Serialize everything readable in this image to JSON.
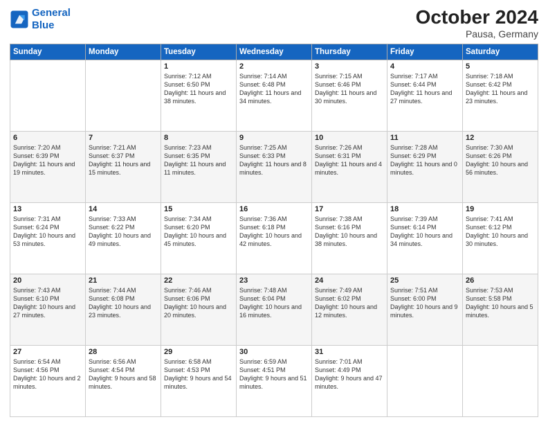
{
  "logo": {
    "line1": "General",
    "line2": "Blue"
  },
  "header": {
    "month": "October 2024",
    "location": "Pausa, Germany"
  },
  "days_of_week": [
    "Sunday",
    "Monday",
    "Tuesday",
    "Wednesday",
    "Thursday",
    "Friday",
    "Saturday"
  ],
  "weeks": [
    [
      {
        "num": "",
        "detail": ""
      },
      {
        "num": "",
        "detail": ""
      },
      {
        "num": "1",
        "detail": "Sunrise: 7:12 AM\nSunset: 6:50 PM\nDaylight: 11 hours and 38 minutes."
      },
      {
        "num": "2",
        "detail": "Sunrise: 7:14 AM\nSunset: 6:48 PM\nDaylight: 11 hours and 34 minutes."
      },
      {
        "num": "3",
        "detail": "Sunrise: 7:15 AM\nSunset: 6:46 PM\nDaylight: 11 hours and 30 minutes."
      },
      {
        "num": "4",
        "detail": "Sunrise: 7:17 AM\nSunset: 6:44 PM\nDaylight: 11 hours and 27 minutes."
      },
      {
        "num": "5",
        "detail": "Sunrise: 7:18 AM\nSunset: 6:42 PM\nDaylight: 11 hours and 23 minutes."
      }
    ],
    [
      {
        "num": "6",
        "detail": "Sunrise: 7:20 AM\nSunset: 6:39 PM\nDaylight: 11 hours and 19 minutes."
      },
      {
        "num": "7",
        "detail": "Sunrise: 7:21 AM\nSunset: 6:37 PM\nDaylight: 11 hours and 15 minutes."
      },
      {
        "num": "8",
        "detail": "Sunrise: 7:23 AM\nSunset: 6:35 PM\nDaylight: 11 hours and 11 minutes."
      },
      {
        "num": "9",
        "detail": "Sunrise: 7:25 AM\nSunset: 6:33 PM\nDaylight: 11 hours and 8 minutes."
      },
      {
        "num": "10",
        "detail": "Sunrise: 7:26 AM\nSunset: 6:31 PM\nDaylight: 11 hours and 4 minutes."
      },
      {
        "num": "11",
        "detail": "Sunrise: 7:28 AM\nSunset: 6:29 PM\nDaylight: 11 hours and 0 minutes."
      },
      {
        "num": "12",
        "detail": "Sunrise: 7:30 AM\nSunset: 6:26 PM\nDaylight: 10 hours and 56 minutes."
      }
    ],
    [
      {
        "num": "13",
        "detail": "Sunrise: 7:31 AM\nSunset: 6:24 PM\nDaylight: 10 hours and 53 minutes."
      },
      {
        "num": "14",
        "detail": "Sunrise: 7:33 AM\nSunset: 6:22 PM\nDaylight: 10 hours and 49 minutes."
      },
      {
        "num": "15",
        "detail": "Sunrise: 7:34 AM\nSunset: 6:20 PM\nDaylight: 10 hours and 45 minutes."
      },
      {
        "num": "16",
        "detail": "Sunrise: 7:36 AM\nSunset: 6:18 PM\nDaylight: 10 hours and 42 minutes."
      },
      {
        "num": "17",
        "detail": "Sunrise: 7:38 AM\nSunset: 6:16 PM\nDaylight: 10 hours and 38 minutes."
      },
      {
        "num": "18",
        "detail": "Sunrise: 7:39 AM\nSunset: 6:14 PM\nDaylight: 10 hours and 34 minutes."
      },
      {
        "num": "19",
        "detail": "Sunrise: 7:41 AM\nSunset: 6:12 PM\nDaylight: 10 hours and 30 minutes."
      }
    ],
    [
      {
        "num": "20",
        "detail": "Sunrise: 7:43 AM\nSunset: 6:10 PM\nDaylight: 10 hours and 27 minutes."
      },
      {
        "num": "21",
        "detail": "Sunrise: 7:44 AM\nSunset: 6:08 PM\nDaylight: 10 hours and 23 minutes."
      },
      {
        "num": "22",
        "detail": "Sunrise: 7:46 AM\nSunset: 6:06 PM\nDaylight: 10 hours and 20 minutes."
      },
      {
        "num": "23",
        "detail": "Sunrise: 7:48 AM\nSunset: 6:04 PM\nDaylight: 10 hours and 16 minutes."
      },
      {
        "num": "24",
        "detail": "Sunrise: 7:49 AM\nSunset: 6:02 PM\nDaylight: 10 hours and 12 minutes."
      },
      {
        "num": "25",
        "detail": "Sunrise: 7:51 AM\nSunset: 6:00 PM\nDaylight: 10 hours and 9 minutes."
      },
      {
        "num": "26",
        "detail": "Sunrise: 7:53 AM\nSunset: 5:58 PM\nDaylight: 10 hours and 5 minutes."
      }
    ],
    [
      {
        "num": "27",
        "detail": "Sunrise: 6:54 AM\nSunset: 4:56 PM\nDaylight: 10 hours and 2 minutes."
      },
      {
        "num": "28",
        "detail": "Sunrise: 6:56 AM\nSunset: 4:54 PM\nDaylight: 9 hours and 58 minutes."
      },
      {
        "num": "29",
        "detail": "Sunrise: 6:58 AM\nSunset: 4:53 PM\nDaylight: 9 hours and 54 minutes."
      },
      {
        "num": "30",
        "detail": "Sunrise: 6:59 AM\nSunset: 4:51 PM\nDaylight: 9 hours and 51 minutes."
      },
      {
        "num": "31",
        "detail": "Sunrise: 7:01 AM\nSunset: 4:49 PM\nDaylight: 9 hours and 47 minutes."
      },
      {
        "num": "",
        "detail": ""
      },
      {
        "num": "",
        "detail": ""
      }
    ]
  ]
}
